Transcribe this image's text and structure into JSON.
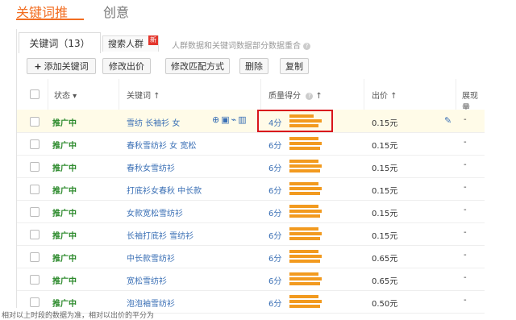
{
  "nav": {
    "tab_keyword": "关键词推",
    "tab_creative": "创意"
  },
  "tabs": {
    "keyword_tab": "关键词（13）",
    "crowd_tab": "搜索人群",
    "new_badge": "新",
    "hint": "人群数据和关键词数据部分数据重合"
  },
  "toolbar": {
    "add_keyword": "添加关键词",
    "edit_price": "修改出价",
    "edit_match": "修改匹配方式",
    "delete": "删除",
    "copy": "复制"
  },
  "table": {
    "headers": {
      "status": "状态",
      "keyword": "关键词",
      "quality_score": "质量得分",
      "price": "出价",
      "impressions": "展现量"
    },
    "rows": [
      {
        "status": "推广中",
        "keyword": "雪纺 长袖衫 女",
        "score": "4分",
        "price": "0.15元",
        "extra": "-",
        "highlight": true
      },
      {
        "status": "推广中",
        "keyword": "春秋雪纺衫 女 宽松",
        "score": "6分",
        "price": "0.15元",
        "extra": "-"
      },
      {
        "status": "推广中",
        "keyword": "春秋女雪纺衫",
        "score": "6分",
        "price": "0.15元",
        "extra": "-"
      },
      {
        "status": "推广中",
        "keyword": "打底衫女春秋 中长款",
        "score": "6分",
        "price": "0.15元",
        "extra": "-"
      },
      {
        "status": "推广中",
        "keyword": "女款宽松雪纺衫",
        "score": "6分",
        "price": "0.15元",
        "extra": "-"
      },
      {
        "status": "推广中",
        "keyword": "长袖打底衫 雪纺衫",
        "score": "6分",
        "price": "0.15元",
        "extra": "-"
      },
      {
        "status": "推广中",
        "keyword": "中长款雪纺衫",
        "score": "6分",
        "price": "0.65元",
        "extra": "-"
      },
      {
        "status": "推广中",
        "keyword": "宽松雪纺衫",
        "score": "6分",
        "price": "0.65元",
        "extra": "-"
      },
      {
        "status": "推广中",
        "keyword": "泡泡袖雪纺衫",
        "score": "6分",
        "price": "0.50元",
        "extra": "-"
      }
    ]
  },
  "footer_text": "相对以上时段的数据为准，相对以出价的平分为"
}
